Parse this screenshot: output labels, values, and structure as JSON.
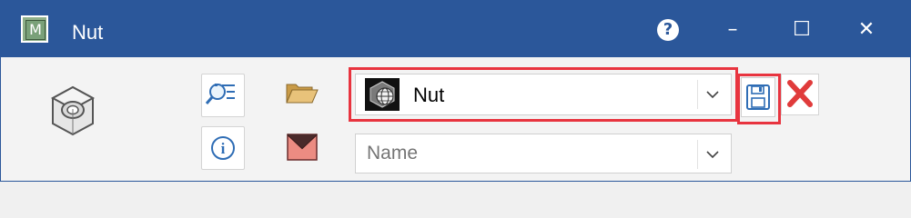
{
  "window": {
    "title": "Nut",
    "app_icon_letter": "M",
    "controls": {
      "help": "?",
      "minimize": "–",
      "maximize": "☐",
      "close": "✕"
    }
  },
  "toolbar": {
    "part_selector": {
      "value": "Nut"
    },
    "name_field": {
      "placeholder": "Name",
      "value": ""
    },
    "info_label": "i"
  },
  "colors": {
    "titlebar": "#2b579a",
    "highlight": "#e8343f",
    "save_blue": "#2f6db5",
    "delete_red": "#e03b3b",
    "folder": "#e2bb6b",
    "mail": "#e9847c"
  },
  "icons": {
    "part": "nut-icon",
    "search": "search-list-icon",
    "info": "info-icon",
    "folder": "folder-open-icon",
    "mail": "envelope-icon",
    "save": "save-icon",
    "delete": "delete-icon"
  }
}
